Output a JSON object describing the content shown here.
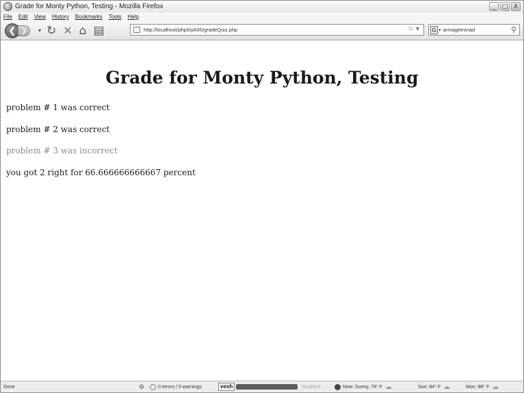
{
  "window": {
    "title": "Grade for Monty Python, Testing - Mozilla Firefox",
    "controls": {
      "minimize": "_",
      "maximize": "□",
      "close": "X"
    }
  },
  "menu": [
    "File",
    "Edit",
    "View",
    "History",
    "Bookmarks",
    "Tools",
    "Help"
  ],
  "nav": {
    "url": "http://localhost/php6/ph06/gradeQuiz.php",
    "search_value": "armagetronad",
    "search_engine": "G"
  },
  "page": {
    "heading": "Grade for Monty Python, Testing",
    "results": [
      {
        "text": "problem # 1 was correct",
        "status": "correct"
      },
      {
        "text": "problem # 2 was correct",
        "status": "correct"
      },
      {
        "text": "problem # 3 was incorrect",
        "status": "incorrect"
      }
    ],
    "summary": "you got 2 right for 66.666666666667 percent"
  },
  "status": {
    "done": "Done",
    "errors": "0 errors / 0 warnings",
    "vesh": "vesh",
    "disabled": "Disabled",
    "weather_now": "Now: Sunny, 79° F",
    "weather_sun": "Sun: 84° F",
    "weather_mon": "Mon: 88° F"
  },
  "colors": {
    "correct": "#1a1a1a",
    "incorrect": "#8a8a8a"
  },
  "icons": [
    "app-icon",
    "back-icon",
    "forward-icon",
    "reload-icon",
    "stop-icon",
    "home-icon",
    "bookmark-icon",
    "site-icon",
    "star-icon",
    "search-icon",
    "gear-icon",
    "weather-icon"
  ]
}
